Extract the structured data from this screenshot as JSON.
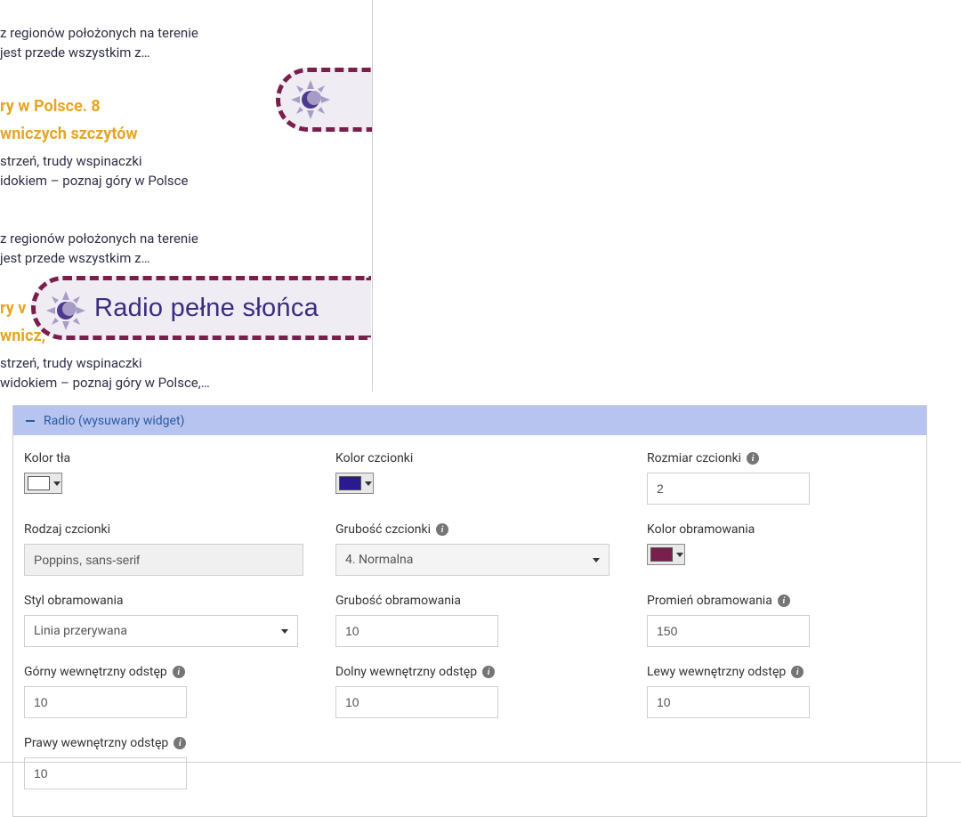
{
  "articles": {
    "a1_line1": "z regionów położonych na terenie",
    "a1_line2": "jest przede wszystkim z…",
    "a2_title_line1": "ry w Polsce. 8",
    "a2_title_line2": "wniczych szczytów",
    "a2_desc_line1": "strzeń, trudy wspinaczki",
    "a2_desc_line2": "idokiem – poznaj góry w Polsce",
    "a3_line1": "z regionów położonych na terenie",
    "a3_line2": "jest przede wszystkim z…",
    "a4_title_line1": "ry v",
    "a4_title_line2": "wnicz,",
    "a4_desc_line1": "strzeń, trudy wspinaczki",
    "a4_desc_line2": "widokiem – poznaj góry w Polsce,…"
  },
  "radio": {
    "label": "Radio pełne słońca"
  },
  "panel": {
    "title": "Radio (wysuwany widget)",
    "colors": {
      "bg": "#ffffff",
      "font": "#2a1a8f",
      "border": "#7a1f4b"
    },
    "labels": {
      "bgColor": "Kolor tła",
      "fontColor": "Kolor czcionki",
      "fontSize": "Rozmiar czcionki",
      "fontFamily": "Rodzaj czcionki",
      "fontWeight": "Grubość czcionki",
      "borderColor": "Kolor obramowania",
      "borderStyle": "Styl obramowania",
      "borderWidth": "Grubość obramowania",
      "borderRadius": "Promień obramowania",
      "padTop": "Górny wewnętrzny odstęp",
      "padBottom": "Dolny wewnętrzny odstęp",
      "padLeft": "Lewy wewnętrzny odstęp",
      "padRight": "Prawy wewnętrzny odstęp"
    },
    "values": {
      "fontSize": "2",
      "fontFamily": "Poppins, sans-serif",
      "fontWeight": "4. Normalna",
      "borderStyle": "Linia przerywana",
      "borderWidth": "10",
      "borderRadius": "150",
      "padTop": "10",
      "padBottom": "10",
      "padLeft": "10",
      "padRight": "10"
    }
  }
}
